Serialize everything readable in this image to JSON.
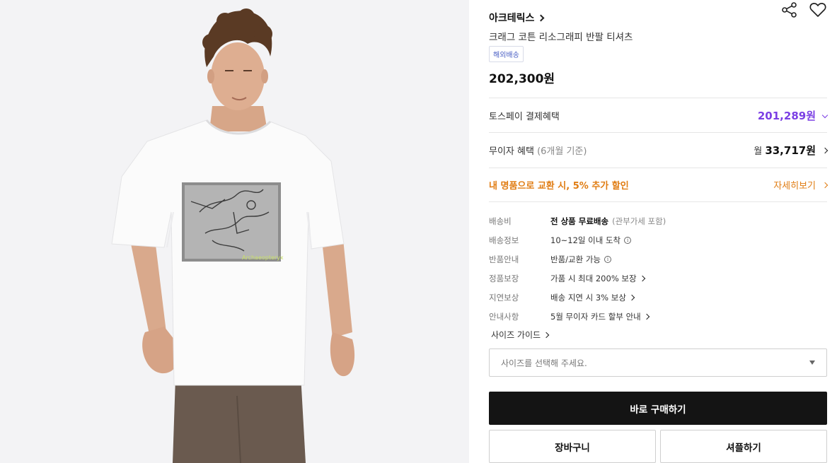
{
  "product": {
    "brand": "아크테릭스",
    "name": "크래그 코튼 리소그래피 반팔 티셔츠",
    "shipping_badge": "해외배송",
    "price": "202,300원",
    "image_graphic_text": "Archaeopteryx"
  },
  "icons": {
    "share": "share-icon",
    "wishlist": "heart-icon"
  },
  "benefits": {
    "toss": {
      "label": "토스페이 결제혜택",
      "price": "201,289원"
    },
    "installment": {
      "label": "무이자 혜택",
      "label_note": "(6개월 기준)",
      "prefix": "월",
      "amount": "33,717원"
    },
    "trade_in": {
      "text": "내 명품으로 교환 시, 5% 추가 할인",
      "link": "자세히보기"
    }
  },
  "info_rows": [
    {
      "key": "배송비",
      "value": "전 상품 무료배송",
      "note": "(관부가세 포함)"
    },
    {
      "key": "배송정보",
      "value": "10~12일 이내 도착"
    },
    {
      "key": "반품안내",
      "value": "반품/교환 가능"
    },
    {
      "key": "정품보장",
      "value": "가품 시 최대 200% 보장"
    },
    {
      "key": "지연보상",
      "value": "배송 지연 시 3% 보상"
    },
    {
      "key": "안내사항",
      "value": "5월 무이자 카드 할부 안내"
    }
  ],
  "size_guide": "사이즈 가이드",
  "size_select": {
    "placeholder": "사이즈를 선택해 주세요."
  },
  "buttons": {
    "buy_now": "바로 구매하기",
    "cart": "장바구니",
    "gift": "셔플하기"
  },
  "colors": {
    "accent_purple": "#7b3fe4",
    "accent_orange": "#e07c12",
    "primary_button": "#141414"
  }
}
